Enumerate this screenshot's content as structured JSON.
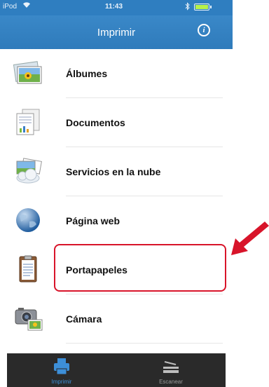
{
  "status_bar": {
    "carrier": "iPod",
    "time": "11:43"
  },
  "header": {
    "title": "Imprimir"
  },
  "menu": {
    "items": [
      {
        "label": "Álbumes",
        "icon": "photo-album-icon"
      },
      {
        "label": "Documentos",
        "icon": "documents-icon"
      },
      {
        "label": "Servicios en la nube",
        "icon": "cloud-services-icon"
      },
      {
        "label": "Página web",
        "icon": "globe-icon"
      },
      {
        "label": "Portapapeles",
        "icon": "clipboard-icon"
      },
      {
        "label": "Cámara",
        "icon": "camera-icon"
      }
    ]
  },
  "tab_bar": {
    "tabs": [
      {
        "label": "Imprimir",
        "icon": "printer-icon",
        "active": true
      },
      {
        "label": "Escanear",
        "icon": "scanner-icon",
        "active": false
      }
    ]
  },
  "colors": {
    "header_blue": "#2f7ec0",
    "active_tab": "#3d8fd8",
    "highlight_red": "#d8142a",
    "tabbar_bg": "#2a2a2a"
  }
}
